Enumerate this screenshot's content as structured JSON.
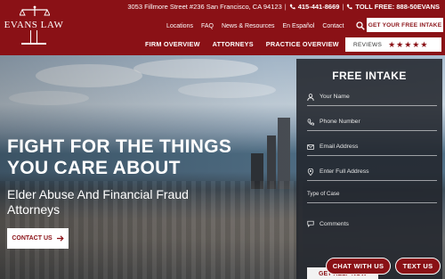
{
  "header": {
    "logo_text": "EVANS LAW",
    "address": "3053 Fillmore Street #236 San Francisco, CA 94123",
    "phone": "415-441-8669",
    "toll_free": "TOLL FREE: 888-50EVANS",
    "nav_top": [
      "Locations",
      "FAQ",
      "News & Resources",
      "En Español",
      "Contact"
    ],
    "cta": "GET YOUR FREE INTAKE",
    "nav_main": [
      "FIRM OVERVIEW",
      "ATTORNEYS",
      "PRACTICE OVERVIEW"
    ],
    "reviews_label": "REVIEWS",
    "stars": "★★★★★",
    "rating": 5
  },
  "hero": {
    "headline_line1": "FIGHT FOR THE THINGS",
    "headline_line2": "YOU CARE ABOUT",
    "subhead": "Elder Abuse And Financial Fraud Attorneys",
    "contact_button": "CONTACT US"
  },
  "form": {
    "title": "FREE INTAKE",
    "fields": {
      "name": "Your Name",
      "phone": "Phone Number",
      "email": "Email Address",
      "address": "Enter Full Address",
      "case_type": "Type of Case",
      "comments": "Comments"
    },
    "submit": "GET HELP NOW"
  },
  "chat": {
    "chat_label": "CHAT WITH US",
    "text_label": "TEXT US"
  },
  "colors": {
    "brand": "#8a1116",
    "panel": "#22262c"
  },
  "icons": [
    "scales-icon",
    "search-icon",
    "star-icon",
    "arrow-right-icon",
    "user-icon",
    "phone-icon",
    "mail-icon",
    "location-pin-icon",
    "chat-bubble-icon"
  ]
}
